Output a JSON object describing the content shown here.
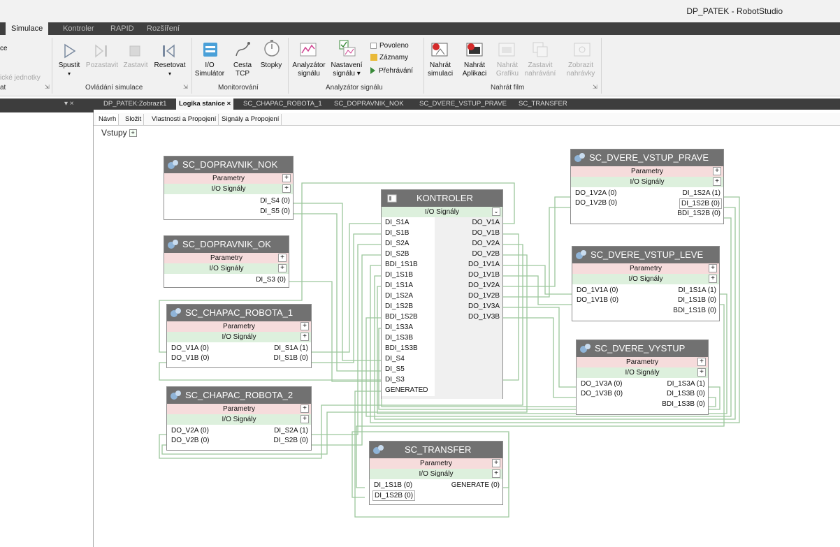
{
  "window": {
    "title": "DP_PATEK - RobotStudio"
  },
  "ribbon_tabs": [
    {
      "label": "Simulace"
    },
    {
      "label": "Kontroler"
    },
    {
      "label": "RAPID"
    },
    {
      "label": "Rozšíření"
    }
  ],
  "ribbon_left": {
    "ce": "ce",
    "jednotky": "ické jednotky",
    "at": "at"
  },
  "ribbon": {
    "spustit": "Spustit",
    "pozastavit": "Pozastavit",
    "zastavit": "Zastavit",
    "resetovat": "Resetovat",
    "io_l1": "I/O",
    "io_l2": "Simulátor",
    "cesta_l1": "Cesta",
    "cesta_l2": "TCP",
    "stopky": "Stopky",
    "analyzator_l1": "Analyzátor",
    "analyzator_l2": "signálu",
    "nastaveni_l1": "Nastavení",
    "nastaveni_l2": "signálu ▾",
    "povoleno": "Povoleno",
    "zaznamy": "Záznamy",
    "prehravani": "Přehrávání",
    "nahrat_sim_l1": "Nahrát",
    "nahrat_sim_l2": "simulaci",
    "nahrat_apl_l1": "Nahrát",
    "nahrat_apl_l2": "Aplikaci",
    "nahrat_graf_l1": "Nahrát",
    "nahrat_graf_l2": "Grafiku",
    "zastavit_nahr_l1": "Zastavit",
    "zastavit_nahr_l2": "nahrávání",
    "zobrazit_l1": "Zobrazit",
    "zobrazit_l2": "nahrávky",
    "group_ovladani": "Ovládání simulace",
    "group_monitor": "Monitorování",
    "group_analyzator": "Analyzátor signálu",
    "group_nahrat": "Nahrát film"
  },
  "doc_tabs": [
    {
      "label": "DP_PATEK:Zobrazit1"
    },
    {
      "label": "Logika stanice ×"
    },
    {
      "label": "SC_CHAPAC_ROBOTA_1"
    },
    {
      "label": "SC_DOPRAVNIK_NOK"
    },
    {
      "label": "SC_DVERE_VSTUP_PRAVE"
    },
    {
      "label": "SC_TRANSFER"
    }
  ],
  "left_panel_close": "▾ ×",
  "sub_tabs": [
    {
      "label": "Návrh"
    },
    {
      "label": "Složit"
    },
    {
      "label": "Vlastnosti a Propojení"
    },
    {
      "label": "Signály a Propojení"
    }
  ],
  "canvas": {
    "vstupy": "Vstupy",
    "plus": "+"
  },
  "section_labels": {
    "parametry": "Parametry",
    "io": "I/O Signály",
    "plus": "+"
  },
  "nodes": {
    "dopravnik_nok": {
      "title": "SC_DOPRAVNIK_NOK",
      "right": [
        "DI_S4 (0)",
        "DI_S5 (0)"
      ]
    },
    "dopravnik_ok": {
      "title": "SC_DOPRAVNIK_OK",
      "right": [
        "DI_S3 (0)"
      ]
    },
    "chapac1": {
      "title": "SC_CHAPAC_ROBOTA_1",
      "left": [
        "DO_V1A (0)",
        "DO_V1B (0)"
      ],
      "right": [
        "DI_S1A (1)",
        "DI_S1B (0)"
      ]
    },
    "chapac2": {
      "title": "SC_CHAPAC_ROBOTA_2",
      "left": [
        "DO_V2A (0)",
        "DO_V2B (0)"
      ],
      "right": [
        "DI_S2A (1)",
        "DI_S2B (0)"
      ]
    },
    "transfer": {
      "title": "SC_TRANSFER",
      "left": [
        "DI_1S1B (0)",
        "DI_1S2B (0)"
      ],
      "right": [
        "GENERATE (0)"
      ]
    },
    "vstup_prave": {
      "title": "SC_DVERE_VSTUP_PRAVE",
      "left": [
        "DO_1V2A (0)",
        "DO_1V2B (0)"
      ],
      "right": [
        "DI_1S2A (1)",
        "DI_1S2B (0)",
        "BDI_1S2B (0)"
      ]
    },
    "vstup_leve": {
      "title": "SC_DVERE_VSTUP_LEVE",
      "left": [
        "DO_1V1A (0)",
        "DO_1V1B (0)"
      ],
      "right": [
        "DI_1S1A (1)",
        "DI_1S1B (0)",
        "BDI_1S1B (0)"
      ]
    },
    "vystup": {
      "title": "SC_DVERE_VYSTUP",
      "left": [
        "DO_1V3A (0)",
        "DO_1V3B (0)"
      ],
      "right": [
        "DI_1S3A (1)",
        "DI_1S3B (0)",
        "BDI_1S3B (0)"
      ]
    }
  },
  "kontroler": {
    "title": "KONTROLER",
    "io": "I/O Signály",
    "inputs": [
      "DI_S1A",
      "DI_S1B",
      "DI_S2A",
      "DI_S2B",
      "BDI_1S1B",
      "DI_1S1B",
      "DI_1S1A",
      "DI_1S2A",
      "DI_1S2B",
      "BDI_1S2B",
      "DI_1S3A",
      "DI_1S3B",
      "BDI_1S3B",
      "DI_S4",
      "DI_S5",
      "DI_S3",
      "GENERATED"
    ],
    "outputs": [
      "DO_V1A",
      "DO_V1B",
      "DO_V2A",
      "DO_V2B",
      "DO_1V1A",
      "DO_1V1B",
      "DO_1V2A",
      "DO_1V2B",
      "DO_1V3A",
      "DO_1V3B"
    ]
  },
  "colors": {
    "wire": "#9cc79c",
    "header": "#717171",
    "param": "#f6dcdc",
    "io": "#ddf0dd"
  }
}
